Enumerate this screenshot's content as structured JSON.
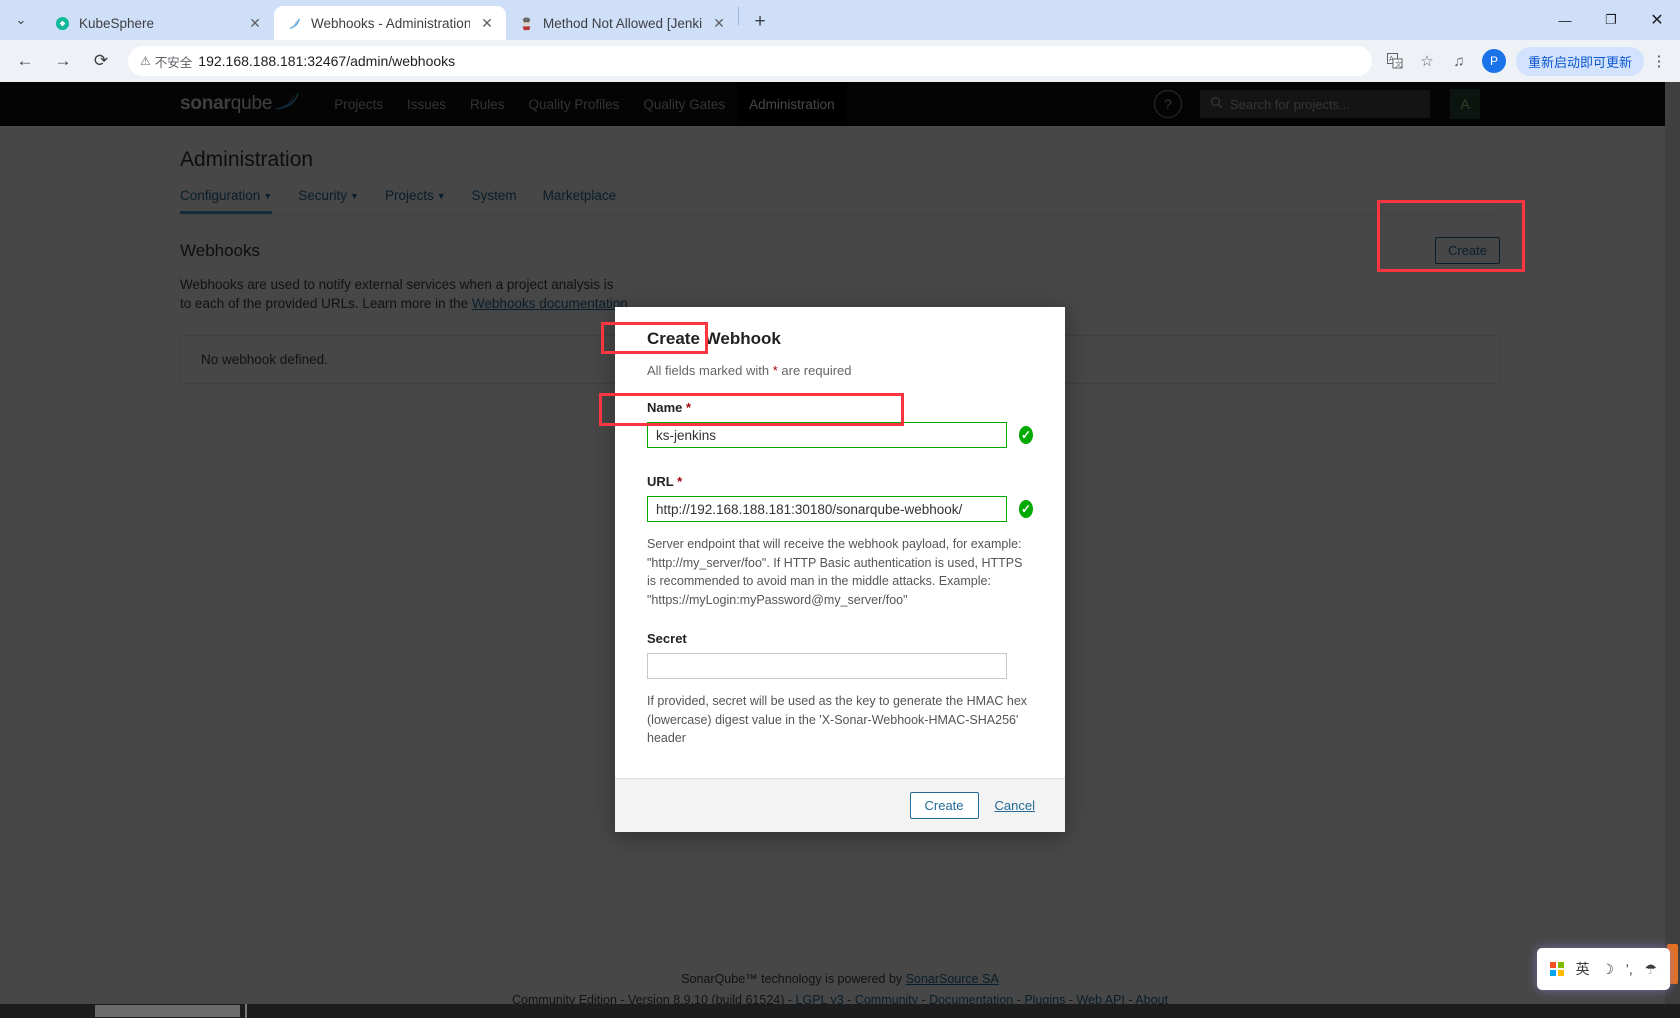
{
  "browser": {
    "tabs": [
      {
        "title": "KubeSphere",
        "favicon": "kubesphere-icon",
        "active": false
      },
      {
        "title": "Webhooks - Administration",
        "favicon": "sonarqube-icon",
        "active": true
      },
      {
        "title": "Method Not Allowed [Jenkins",
        "favicon": "jenkins-icon",
        "active": false
      }
    ],
    "tab_close_label": "✕",
    "new_tab_label": "+",
    "tablist_dropdown": "⌄",
    "window": {
      "minimize": "—",
      "maximize": "❐",
      "close": "✕"
    },
    "nav": {
      "back": "←",
      "forward": "→",
      "reload": "⟳"
    },
    "omnibox": {
      "security_icon": "warning-triangle-icon",
      "security_label": "不安全",
      "url": "192.168.188.181:32467/admin/webhooks"
    },
    "toolbar_icons": {
      "translate": "translate-icon",
      "bookmark": "star-icon",
      "reading_list": "reading-list-icon",
      "profile_initial": "P"
    },
    "update_pill": "重新启动即可更新",
    "menu_kebab": "⋮"
  },
  "sonarqube": {
    "logo": {
      "bold": "sonar",
      "light": "qube",
      "swoosh": "✐"
    },
    "menu": [
      {
        "label": "Projects",
        "active": false
      },
      {
        "label": "Issues",
        "active": false
      },
      {
        "label": "Rules",
        "active": false
      },
      {
        "label": "Quality Profiles",
        "active": false
      },
      {
        "label": "Quality Gates",
        "active": false
      },
      {
        "label": "Administration",
        "active": true
      }
    ],
    "help_icon": "?",
    "search": {
      "icon": "search-icon",
      "placeholder": "Search for projects..."
    },
    "avatar": "A"
  },
  "admin": {
    "page_title": "Administration",
    "subnav": [
      {
        "label": "Configuration",
        "has_caret": true,
        "active": true
      },
      {
        "label": "Security",
        "has_caret": true,
        "active": false
      },
      {
        "label": "Projects",
        "has_caret": true,
        "active": false
      },
      {
        "label": "System",
        "has_caret": false,
        "active": false
      },
      {
        "label": "Marketplace",
        "has_caret": false,
        "active": false
      }
    ]
  },
  "webhooks": {
    "heading": "Webhooks",
    "description_1": "Webhooks are used to notify external services when a project analysis is ",
    "description_2": "to each of the provided URLs. Learn more in the ",
    "description_link": "Webhooks documentation",
    "create_button": "Create",
    "empty_state": "No webhook defined."
  },
  "modal": {
    "title": "Create Webhook",
    "required_note_pre": "All fields marked with ",
    "required_note_star": "*",
    "required_note_post": " are required",
    "name": {
      "label": "Name",
      "required_mark": "*",
      "value": "ks-jenkins",
      "valid_icon": "check-circle-icon"
    },
    "url": {
      "label": "URL",
      "required_mark": "*",
      "value": "http://192.168.188.181:30180/sonarqube-webhook/",
      "valid_icon": "check-circle-icon",
      "help": "Server endpoint that will receive the webhook payload, for example: \"http://my_server/foo\". If HTTP Basic authentication is used, HTTPS is recommended to avoid man in the middle attacks. Example: \"https://myLogin:myPassword@my_server/foo\""
    },
    "secret": {
      "label": "Secret",
      "value": "",
      "help": "If provided, secret will be used as the key to generate the HMAC hex (lowercase) digest value in the 'X-Sonar-Webhook-HMAC-SHA256' header"
    },
    "submit": "Create",
    "cancel": "Cancel"
  },
  "footer": {
    "line1": "SonarQube™ technology is powered by ",
    "line1_link": "SonarSource SA",
    "edition": "Community Edition - Version 8.9.10 (build 61524) - ",
    "links": [
      "LGPL v3",
      "Community",
      "Documentation",
      "Plugins",
      "Web API",
      "About"
    ],
    "separator": " - "
  },
  "ime": {
    "ms_logo": "microsoft-logo-icon",
    "mode": "英",
    "moon": "☽",
    "comma": "’,",
    "shape": "☂"
  },
  "colors": {
    "accent_blue": "#236a97",
    "sonar_blue": "#4b9fd5",
    "valid_green": "#00aa00",
    "annotation_red": "#fb3640",
    "navbar_dark": "#100f0f"
  }
}
